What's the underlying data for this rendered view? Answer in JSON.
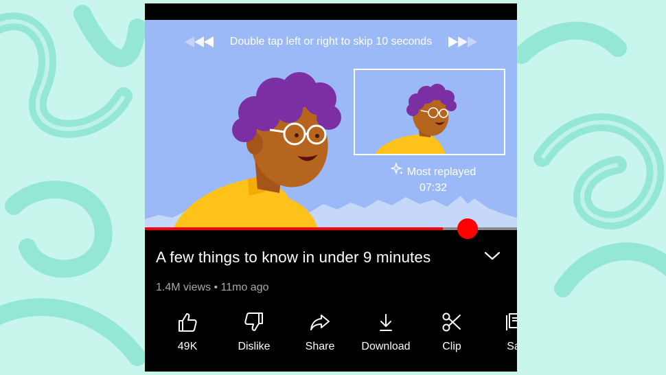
{
  "player": {
    "skip_hint": "Double tap left or right to skip 10 seconds",
    "most_replayed_label": "Most replayed",
    "most_replayed_time": "07:32",
    "progress_fraction": 0.8
  },
  "video": {
    "title": "A few things to know in under 9 minutes",
    "meta": "1.4M views • 11mo ago"
  },
  "actions": [
    {
      "label": "49K",
      "icon": "thumbs-up-icon"
    },
    {
      "label": "Dislike",
      "icon": "thumbs-down-icon"
    },
    {
      "label": "Share",
      "icon": "share-icon"
    },
    {
      "label": "Download",
      "icon": "download-icon"
    },
    {
      "label": "Clip",
      "icon": "scissors-icon"
    },
    {
      "label": "Sa",
      "icon": "save-icon"
    }
  ],
  "colors": {
    "background": "#c9f6ec",
    "player_bg": "#9bb9f7",
    "accent_red": "#ff0000",
    "hair": "#7b2fa3",
    "skin": "#b5651d",
    "shirt": "#ffc21a"
  }
}
